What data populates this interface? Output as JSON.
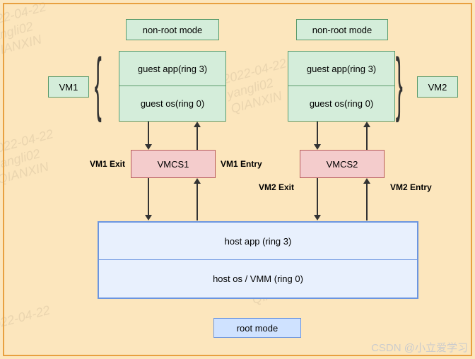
{
  "watermark": {
    "line1": "2022-04-22",
    "line2": "yangli02",
    "line3": "QIANXIN"
  },
  "vm1": {
    "mode_label": "non-root mode",
    "side_label": "VM1",
    "guest_app": "guest app(ring 3)",
    "guest_os": "guest os(ring 0)",
    "vmcs": "VMCS1",
    "exit_label": "VM1 Exit",
    "entry_label": "VM1 Entry"
  },
  "vm2": {
    "mode_label": "non-root mode",
    "side_label": "VM2",
    "guest_app": "guest app(ring 3)",
    "guest_os": "guest os(ring 0)",
    "vmcs": "VMCS2",
    "exit_label": "VM2 Exit",
    "entry_label": "VM2 Entry"
  },
  "host": {
    "app": "host app (ring 3)",
    "os": "host os / VMM (ring 0)",
    "mode_label": "root mode"
  },
  "attribution": "CSDN @小立爱学习"
}
